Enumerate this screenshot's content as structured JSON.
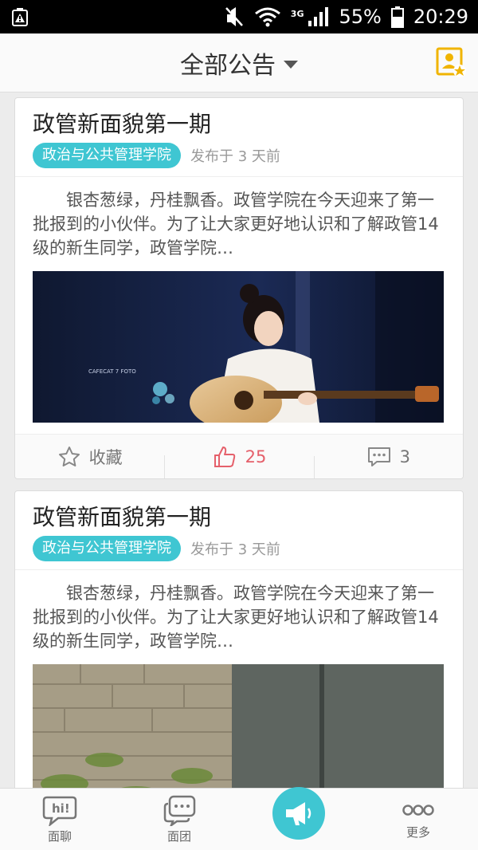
{
  "status_bar": {
    "network_type": "3G",
    "battery_percent": "55%",
    "time": "20:29",
    "icons": [
      "warning-icon",
      "mute-icon",
      "wifi-icon",
      "signal-icon",
      "battery-icon"
    ]
  },
  "header": {
    "title": "全部公告",
    "profile_icon": "profile-card-icon",
    "accent": "#f0b400"
  },
  "feed": {
    "posts": [
      {
        "title": "政管新面貌第一期",
        "department": "政治与公共管理学院",
        "published": "发布于 3 天前",
        "excerpt": "银杏葱绿，丹桂飘香。政管学院在今天迎来了第一批报到的小伙伴。为了让大家更好地认识和了解政管14级的新生同学，政管学院…",
        "photo_caption": "CAFECAT 7    FOTO",
        "actions": {
          "favorite_label": "收藏",
          "likes": "25",
          "comments": "3"
        }
      },
      {
        "title": "政管新面貌第一期",
        "department": "政治与公共管理学院",
        "published": "发布于 3 天前",
        "excerpt": "银杏葱绿，丹桂飘香。政管学院在今天迎来了第一批报到的小伙伴。为了让大家更好地认识和了解政管14级的新生同学，政管学院…"
      }
    ]
  },
  "bottom_nav": {
    "tabs": [
      {
        "label": "面聊",
        "icon": "hi-bubble-icon"
      },
      {
        "label": "面团",
        "icon": "group-chat-icon"
      },
      {
        "label": "",
        "icon": "megaphone-icon"
      },
      {
        "label": "更多",
        "icon": "more-icon"
      }
    ],
    "accent": "#3fc6d2"
  }
}
